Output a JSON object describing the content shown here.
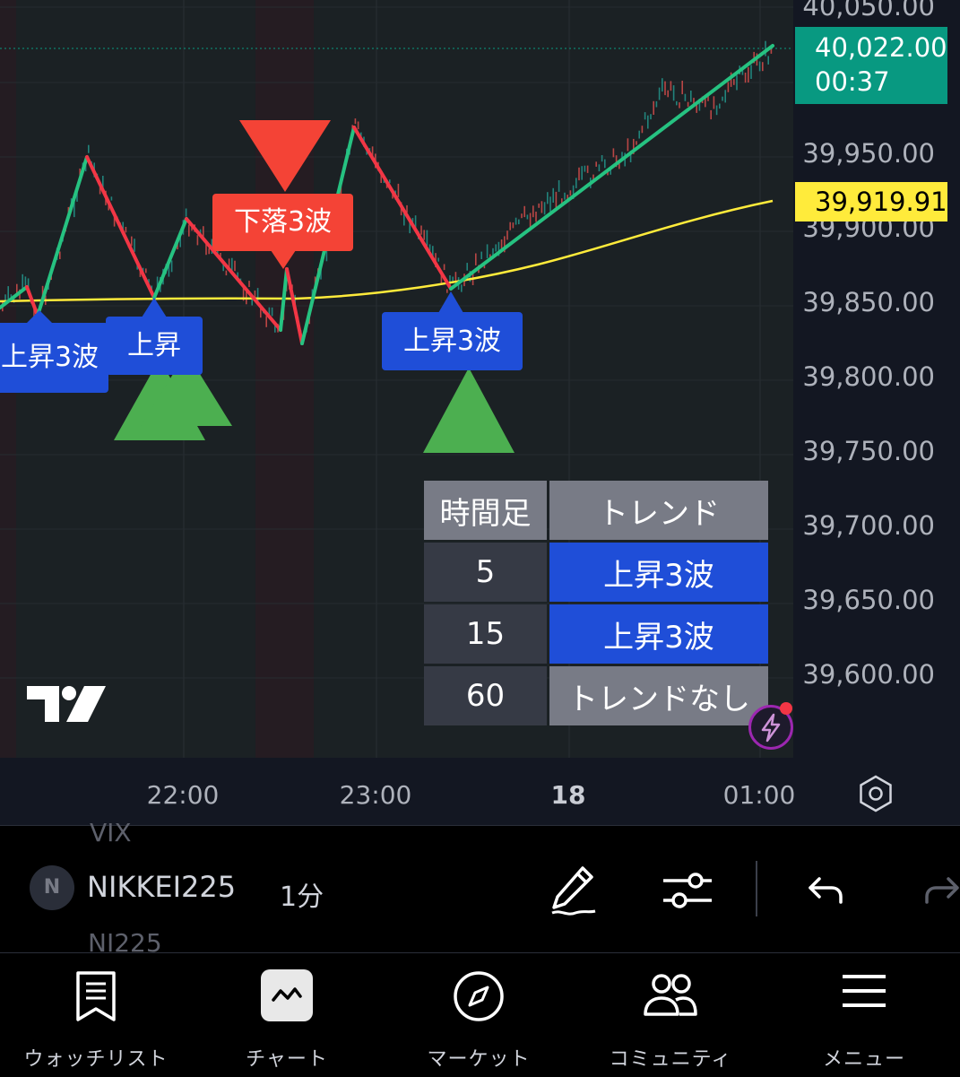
{
  "chart": {
    "price_labels": [
      "40,050.00",
      "39,950.00",
      "39,900.00",
      "39,850.00",
      "39,800.00",
      "39,750.00",
      "39,700.00",
      "39,650.00",
      "39,600.00"
    ],
    "last_price": "40,022.00",
    "countdown": "00:37",
    "ma_value": "39,919.91",
    "time_labels": [
      "22:00",
      "23:00",
      "18",
      "01:00"
    ],
    "labels": {
      "up3_left": "上昇3波",
      "up_mid": "上昇",
      "down3": "下落3波",
      "up3_right": "上昇3波"
    },
    "colors": {
      "up": "#26c281",
      "down": "#f23645",
      "ma": "#ffeb3b",
      "label_blue": "#1f4ed8",
      "label_red": "#f44336",
      "triangle_green": "#4caf50"
    }
  },
  "trend_table": {
    "header": [
      "時間足",
      "トレンド"
    ],
    "rows": [
      {
        "tf": "5",
        "trend": "上昇3波"
      },
      {
        "tf": "15",
        "trend": "上昇3波"
      },
      {
        "tf": "60",
        "trend": "トレンドなし"
      }
    ]
  },
  "toolbar": {
    "symbol_above": "VIX",
    "symbol": "NIKKEI225",
    "symbol_below": "NI225",
    "avatar_letter": "N",
    "interval": "1分"
  },
  "nav": {
    "watchlist": "ウォッチリスト",
    "chart": "チャート",
    "market": "マーケット",
    "community": "コミュニティ",
    "menu": "メニュー"
  }
}
